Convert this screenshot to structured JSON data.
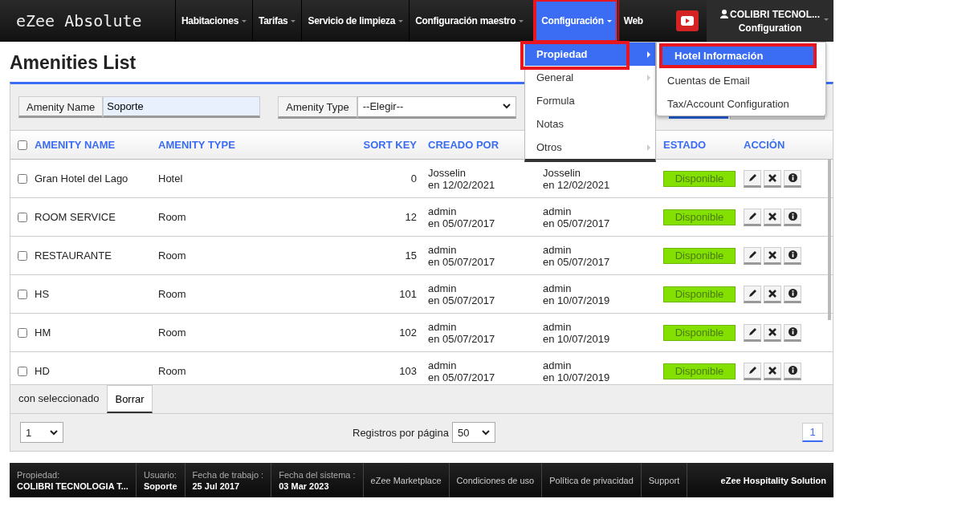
{
  "logo": "eZee Absolute",
  "nav": [
    {
      "label": "Habitaciones",
      "caret": true,
      "selected": false,
      "highlighted": false
    },
    {
      "label": "Tarifas",
      "caret": true,
      "selected": false,
      "highlighted": false
    },
    {
      "label": "Servicio de limpieza",
      "caret": true,
      "selected": false,
      "highlighted": false
    },
    {
      "label": "Configuración maestro",
      "caret": true,
      "selected": false,
      "highlighted": false
    },
    {
      "label": "Configuración",
      "caret": true,
      "selected": true,
      "highlighted": true
    },
    {
      "label": "Web",
      "caret": false,
      "selected": false,
      "highlighted": false
    }
  ],
  "user": {
    "name": "COLIBRI TECNOL...",
    "subtitle": "Configuration"
  },
  "menu": [
    {
      "label": "Propiedad",
      "submenu": true,
      "selected": true,
      "highlighted": true
    },
    {
      "label": "General",
      "submenu": true,
      "selected": false,
      "highlighted": false
    },
    {
      "label": "Formula",
      "submenu": false,
      "selected": false,
      "highlighted": false
    },
    {
      "label": "Notas",
      "submenu": false,
      "selected": false,
      "highlighted": false
    },
    {
      "label": "Otros",
      "submenu": true,
      "selected": false,
      "highlighted": false
    }
  ],
  "submenu": [
    {
      "label": "Hotel Información",
      "selected": true,
      "highlighted": true
    },
    {
      "label": "Cuentas de Email",
      "selected": false,
      "highlighted": false
    },
    {
      "label": "Tax/Account Configuration",
      "selected": false,
      "highlighted": false
    }
  ],
  "page_title": "Amenities List",
  "filters": {
    "name_label": "Amenity Name",
    "name_value": "Soporte",
    "type_label": "Amenity Type",
    "type_value": "--Elegir--"
  },
  "table": {
    "all_checked": false,
    "columns": [
      "AMENITY NAME",
      "AMENITY TYPE",
      "SORT KEY",
      "CREADO POR",
      "ESTADO",
      "ACCIÓN"
    ],
    "rows": [
      {
        "name": "Gran Hotel del Lago",
        "type": "Hotel",
        "sort_key": "0",
        "created_by": "Josselin",
        "created_on": "en 12/02/2021",
        "column_5_by": "Josselin",
        "column_5_on": "en 12/02/2021",
        "status": "Disponible",
        "checked": false
      },
      {
        "name": "ROOM SERVICE",
        "type": "Room",
        "sort_key": "12",
        "created_by": "admin",
        "created_on": "en 05/07/2017",
        "column_5_by": "admin",
        "column_5_on": "en 05/07/2017",
        "status": "Disponible",
        "checked": false
      },
      {
        "name": "RESTAURANTE",
        "type": "Room",
        "sort_key": "15",
        "created_by": "admin",
        "created_on": "en 05/07/2017",
        "column_5_by": "admin",
        "column_5_on": "en 05/07/2017",
        "status": "Disponible",
        "checked": false
      },
      {
        "name": "HS",
        "type": "Room",
        "sort_key": "101",
        "created_by": "admin",
        "created_on": "en 05/07/2017",
        "column_5_by": "admin",
        "column_5_on": "en 10/07/2019",
        "status": "Disponible",
        "checked": false
      },
      {
        "name": "HM",
        "type": "Room",
        "sort_key": "102",
        "created_by": "admin",
        "created_on": "en 05/07/2017",
        "column_5_by": "admin",
        "column_5_on": "en 10/07/2019",
        "status": "Disponible",
        "checked": false
      },
      {
        "name": "HD",
        "type": "Room",
        "sort_key": "103",
        "created_by": "admin",
        "created_on": "en 05/07/2017",
        "column_5_by": "admin",
        "column_5_on": "en 10/07/2019",
        "status": "Disponible",
        "checked": false
      }
    ]
  },
  "bulk": {
    "label": "con seleccionado",
    "button": "Borrar"
  },
  "pagination": {
    "page_select": "1",
    "per_page_label": "Registros por página",
    "per_page": "50",
    "pages": [
      {
        "label": "1",
        "selected": true
      }
    ]
  },
  "footer": [
    {
      "label": "Propiedad:",
      "value": "COLIBRI TECNOLOGIA T..."
    },
    {
      "label": "Usuario:",
      "value": "Soporte"
    },
    {
      "label": "Fecha de trabajo :",
      "value": "25 Jul 2017"
    },
    {
      "label": "Fecha del sistema :",
      "value": "03 Mar 2023"
    }
  ],
  "footer_links": [
    "eZee Marketplace",
    "Condiciones de uso",
    "Política de privacidad",
    "Support"
  ],
  "footer_brand": "eZee Hospitality Solution"
}
